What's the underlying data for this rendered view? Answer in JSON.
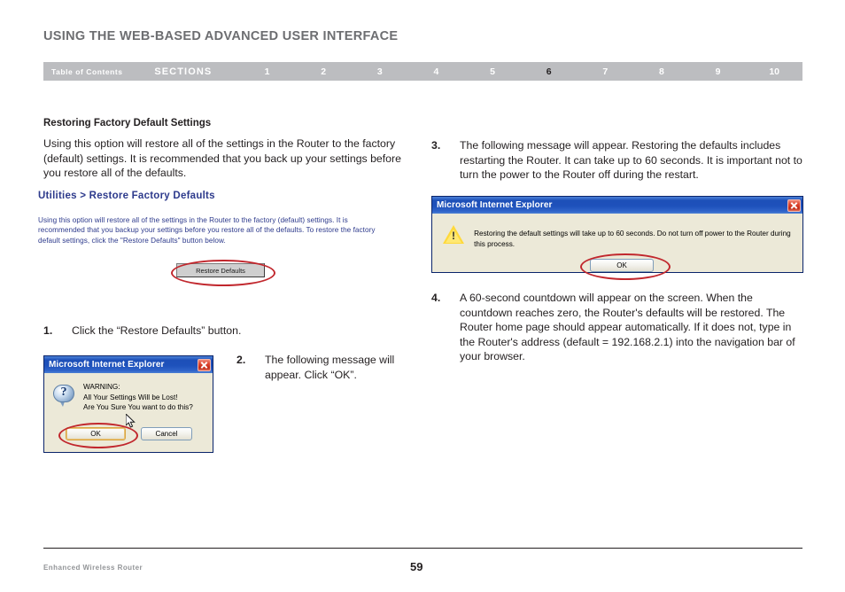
{
  "header": {
    "title": "USING THE WEB-BASED ADVANCED USER INTERFACE"
  },
  "nav": {
    "toc_label": "Table of Contents",
    "sections_label": "SECTIONS",
    "numbers": [
      "1",
      "2",
      "3",
      "4",
      "5",
      "6",
      "7",
      "8",
      "9",
      "10"
    ],
    "active_number": "6",
    "bar_color": "#bcbdc0",
    "active_color": "#231f20"
  },
  "left_column": {
    "heading": "Restoring Factory Default Settings",
    "intro": "Using this option will restore all of the settings in the Router to the factory (default) settings. It is recommended that you back up your settings before you restore all of the defaults."
  },
  "router_ui": {
    "heading": "Utilities > Restore Factory Defaults",
    "heading_color": "#2d3a8c",
    "body_text": "Using this option will restore all of the settings in the Router to the factory (default) settings. It is recommended that you backup your settings before you restore all of the defaults. To restore the factory default settings, click the \"Restore Defaults\" button below.",
    "button_label": "Restore Defaults",
    "annotation_color": "#c1272d"
  },
  "steps": {
    "step1": {
      "number": "1.",
      "text": "Click the “Restore Defaults” button."
    },
    "step2": {
      "number": "2.",
      "text": "The following message will appear. Click “OK”."
    },
    "step3": {
      "number": "3.",
      "text": "The following message will appear. Restoring the defaults includes restarting the Router. It can take up to 60 seconds. It is important not to turn the power to the Router off during the restart."
    },
    "step4": {
      "number": "4.",
      "text": "A 60-second countdown will appear on the screen. When the countdown reaches zero, the Router's defaults will be restored. The Router home page should appear automatically. If it does not, type in the Router's address (default = 192.168.2.1) into the navigation bar of your browser."
    }
  },
  "dialog_warning": {
    "title": "Microsoft Internet Explorer",
    "icon": "question-bubble-icon",
    "close_icon": "close-icon",
    "message_line1": "WARNING:",
    "message_line2": "All Your Settings Will be Lost!",
    "message_line3": "Are You Sure You want to do this?",
    "ok_label": "OK",
    "cancel_label": "Cancel",
    "titlebar_color": "#1e51bb",
    "body_color": "#ece9d8"
  },
  "dialog_restoring": {
    "title": "Microsoft Internet Explorer",
    "icon": "warning-triangle-icon",
    "close_icon": "close-icon",
    "message": "Restoring the default settings will take up to 60 seconds. Do not turn off power to the Router during this process.",
    "ok_label": "OK",
    "titlebar_color": "#1e51bb",
    "body_color": "#ece9d8"
  },
  "footer": {
    "left_text": "Enhanced Wireless Router",
    "page_number": "59"
  }
}
